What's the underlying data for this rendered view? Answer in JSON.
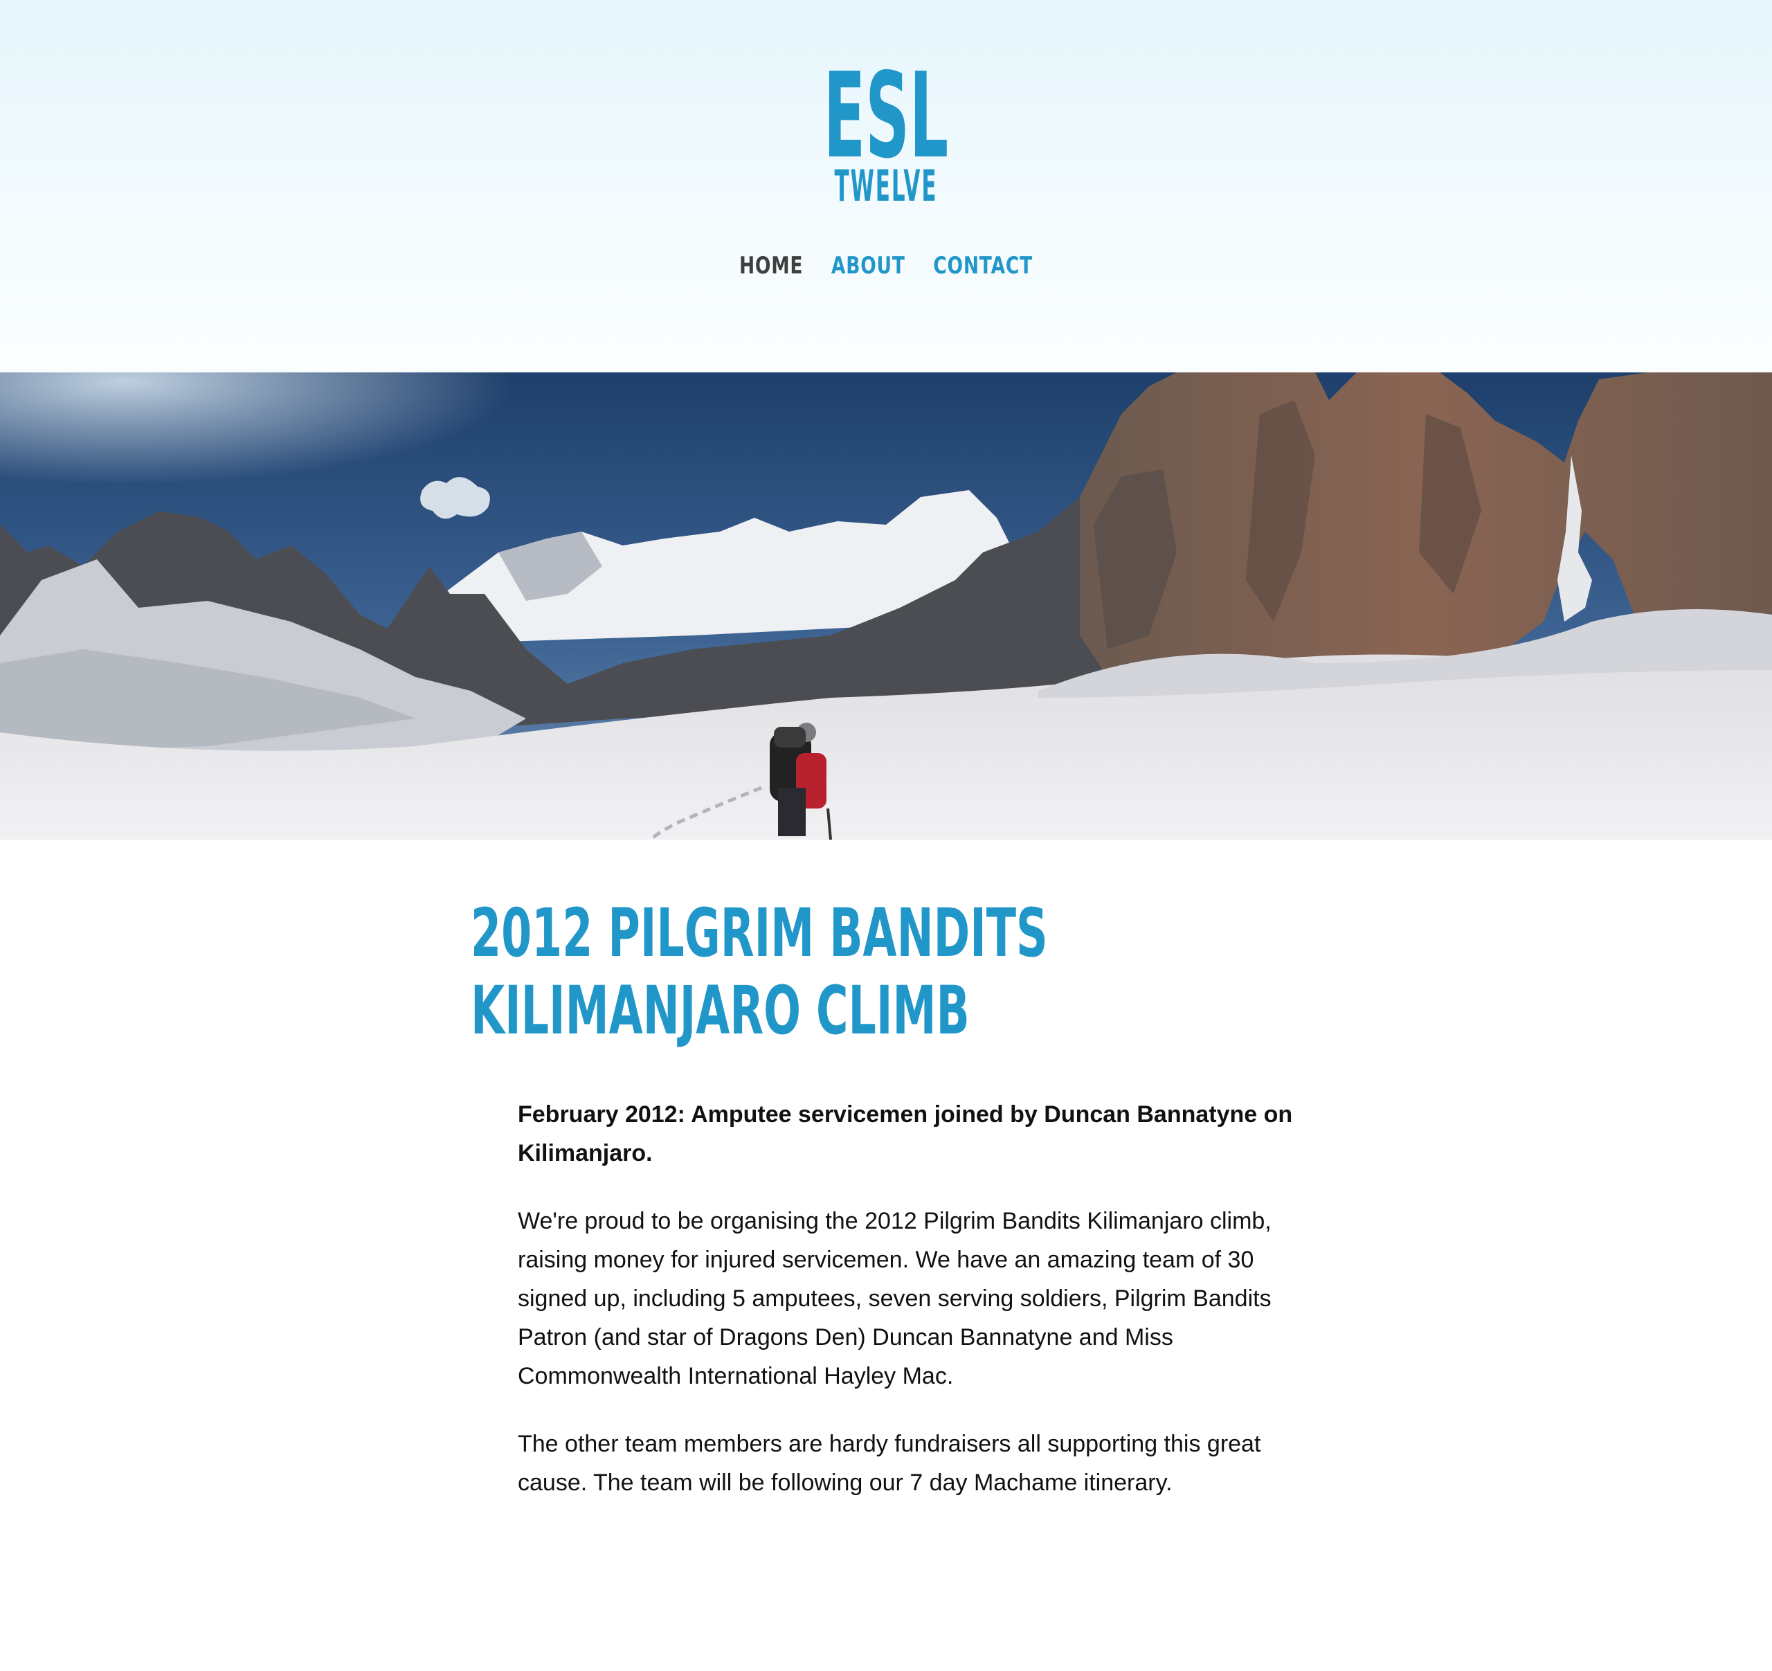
{
  "logo": {
    "line1": "ESL",
    "line2": "TWELVE",
    "color": "#2196c9"
  },
  "nav": {
    "items": [
      {
        "label": "HOME",
        "active": true
      },
      {
        "label": "ABOUT",
        "active": false
      },
      {
        "label": "CONTACT",
        "active": false
      }
    ],
    "active_color": "#3f3f3f",
    "link_color": "#2196c9"
  },
  "hero": {
    "icon": "mountain-panorama-image"
  },
  "article": {
    "title_line1": "2012 PILGRIM BANDITS",
    "title_line2": "KILIMANJARO CLIMB",
    "lead": "February 2012: Amputee servicemen joined by Duncan Bannatyne on Kilimanjaro.",
    "paragraph1": "We're proud to be organising the 2012 Pilgrim Bandits Kilimanjaro climb, raising money for injured servicemen. We have an amazing team of 30 signed up, including 5 amputees, seven serving soldiers, Pilgrim Bandits Patron (and star of Dragons Den) Duncan Bannatyne and Miss Commonwealth International Hayley Mac.",
    "paragraph2": "The other team members are hardy fundraisers all supporting this great cause. The team will be following our 7 day Machame itinerary."
  }
}
